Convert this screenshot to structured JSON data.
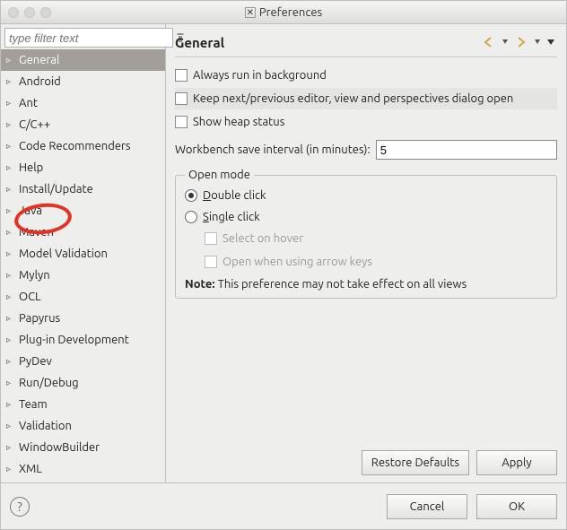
{
  "window": {
    "title": "Preferences",
    "title_prefix": "✕"
  },
  "filter": {
    "placeholder": "type filter text"
  },
  "tree": {
    "items": [
      {
        "label": "General",
        "selected": true
      },
      {
        "label": "Android"
      },
      {
        "label": "Ant"
      },
      {
        "label": "C/C++"
      },
      {
        "label": "Code Recommenders"
      },
      {
        "label": "Help"
      },
      {
        "label": "Install/Update"
      },
      {
        "label": "Java"
      },
      {
        "label": "Maven"
      },
      {
        "label": "Model Validation"
      },
      {
        "label": "Mylyn"
      },
      {
        "label": "OCL"
      },
      {
        "label": "Papyrus"
      },
      {
        "label": "Plug-in Development"
      },
      {
        "label": "PyDev"
      },
      {
        "label": "Run/Debug"
      },
      {
        "label": "Team"
      },
      {
        "label": "Validation"
      },
      {
        "label": "WindowBuilder"
      },
      {
        "label": "XML"
      }
    ]
  },
  "page": {
    "title": "General",
    "checks": {
      "run_bg": "Always run in background",
      "keep_editor": "Keep next/previous editor, view and perspectives dialog open",
      "show_heap": "Show heap status"
    },
    "interval_label": "Workbench save interval (in minutes):",
    "interval_value": "5",
    "open_mode": {
      "legend": "Open mode",
      "double": "Double click",
      "single": "Single click",
      "hover": "Select on hover",
      "arrow": "Open when using arrow keys",
      "note_prefix": "Note:",
      "note_text": " This preference may not take effect on all views"
    }
  },
  "buttons": {
    "restore": "Restore Defaults",
    "apply": "Apply",
    "cancel": "Cancel",
    "ok": "OK"
  }
}
